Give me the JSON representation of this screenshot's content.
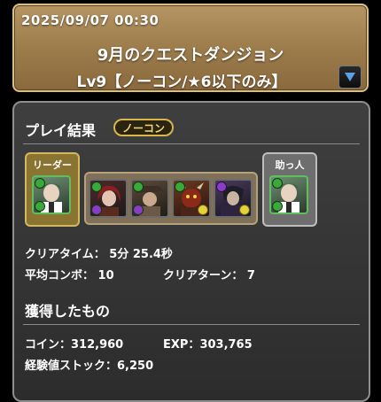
{
  "header": {
    "date": "2025/09/07 00:30",
    "title": "9月のクエストダンジョン",
    "subtitle": "Lv9【ノーコン/★6以下のみ】"
  },
  "result": {
    "heading": "プレイ結果",
    "badge": "ノーコン",
    "leader_label": "リーダー",
    "helper_label": "助っ人",
    "clear_time_label": "クリアタイム：",
    "clear_time_value": "5分 25.4秒",
    "avg_combo_label": "平均コンボ：",
    "avg_combo_value": "10",
    "clear_turn_label": "クリアターン：",
    "clear_turn_value": "7"
  },
  "rewards": {
    "heading": "獲得したもの",
    "coin_label": "コイン：",
    "coin_value": "312,960",
    "exp_label": "EXP：",
    "exp_value": "303,765",
    "stock_label": "経験値ストック：",
    "stock_value": "6,250"
  },
  "colors": {
    "header_bg": "#9b7a4a",
    "panel_bg": "#333333",
    "badge_gold": "#d9b64a",
    "wood_orb": "#3aa83a",
    "dark_orb": "#8a3cc8",
    "light_orb": "#e6d23a"
  },
  "monsters": [
    {
      "slot": "leader",
      "portrait": "green-hair-man",
      "attr": "wood",
      "sub_attr": "wood"
    },
    {
      "slot": "sub1",
      "portrait": "red-hair-girl",
      "attr": "wood",
      "sub_attr": "dark"
    },
    {
      "slot": "sub2",
      "portrait": "hat-warrior",
      "attr": "wood",
      "sub_attr": "dark"
    },
    {
      "slot": "sub3",
      "portrait": "red-demon",
      "attr": "wood",
      "sub_attr": "light"
    },
    {
      "slot": "sub4",
      "portrait": "dark-knight",
      "attr": "dark",
      "sub_attr": "light"
    },
    {
      "slot": "helper",
      "portrait": "green-hair-man",
      "attr": "wood",
      "sub_attr": "wood"
    }
  ]
}
